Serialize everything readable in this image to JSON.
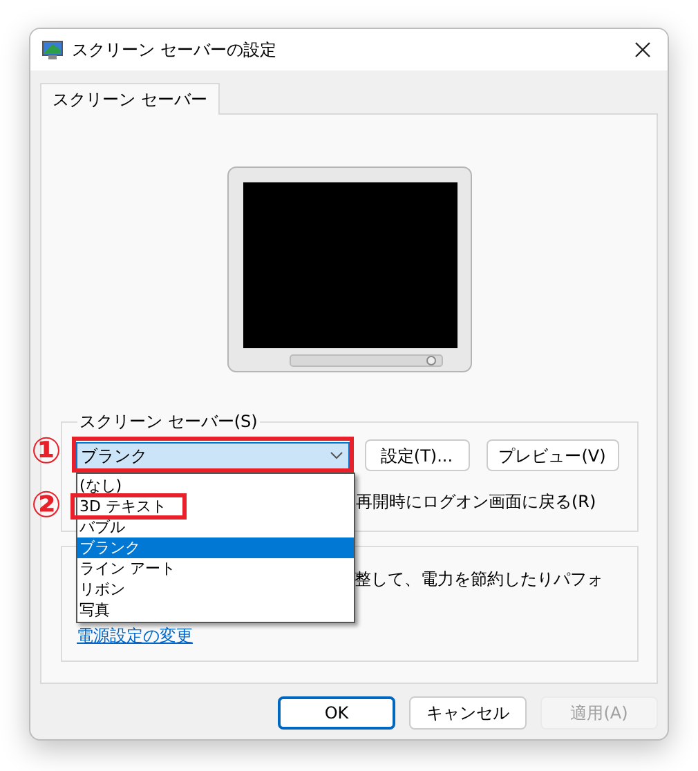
{
  "window": {
    "title": "スクリーン セーバーの設定"
  },
  "tabs": [
    {
      "label": "スクリーン セーバー",
      "selected": true
    }
  ],
  "screen_saver_group": {
    "label": "スクリーン セーバー(S)",
    "combo": {
      "value": "ブランク",
      "expanded": true
    },
    "buttons": [
      "設定(T)...",
      "プレビュー(V)"
    ],
    "options": [
      {
        "label": "(なし)",
        "selected": false
      },
      {
        "label": "3D テキスト",
        "selected": false
      },
      {
        "label": "バブル",
        "selected": false
      },
      {
        "label": "ブランク",
        "selected": true
      },
      {
        "label": "ライン アート",
        "selected": false
      },
      {
        "label": "リボン",
        "selected": false
      },
      {
        "label": "写真",
        "selected": false
      }
    ],
    "resume_checkbox_label": "再開時にログオン画面に戻る(R)"
  },
  "power_group": {
    "text": "整して、電力を節約したりパフォ",
    "link": "電源設定の変更"
  },
  "buttons": [
    {
      "label": "OK",
      "default": true,
      "disabled": false
    },
    {
      "label": "キャンセル",
      "default": false,
      "disabled": false
    },
    {
      "label": "適用(A)",
      "default": false,
      "disabled": true
    }
  ],
  "annotations": [
    {
      "label": "①"
    },
    {
      "label": "②"
    }
  ]
}
